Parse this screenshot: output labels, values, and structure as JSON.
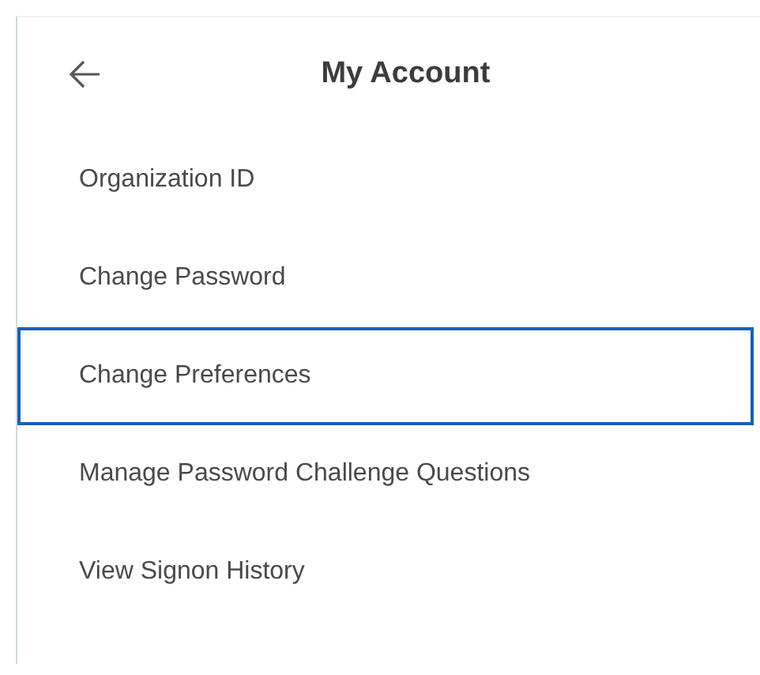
{
  "header": {
    "title": "My Account"
  },
  "items": [
    {
      "label": "Organization ID",
      "selected": false
    },
    {
      "label": "Change Password",
      "selected": false
    },
    {
      "label": "Change Preferences",
      "selected": true
    },
    {
      "label": "Manage Password Challenge Questions",
      "selected": false
    },
    {
      "label": "View Signon History",
      "selected": false
    }
  ]
}
